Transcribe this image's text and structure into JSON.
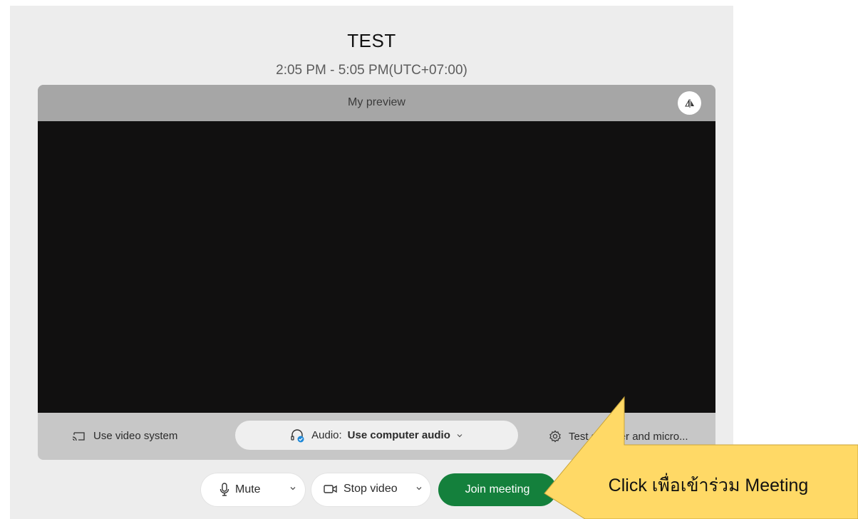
{
  "meeting": {
    "title": "TEST",
    "time": "2:05 PM - 5:05 PM(UTC+07:00)"
  },
  "preview": {
    "title": "My preview",
    "mirror_icon": "mirror-icon"
  },
  "options": {
    "video_system_label": "Use video system",
    "audio_prefix": "Audio:",
    "audio_value": "Use computer audio",
    "test_label": "Test speaker and micro..."
  },
  "controls": {
    "mute_label": "Mute",
    "stop_video_label": "Stop video",
    "join_label": "Join meeting"
  },
  "callout": {
    "text": "Click เพื่อเข้าร่วม Meeting",
    "color": "#ffd966"
  },
  "colors": {
    "join": "#14803c",
    "panel": "#ededed",
    "video": "#111010"
  }
}
